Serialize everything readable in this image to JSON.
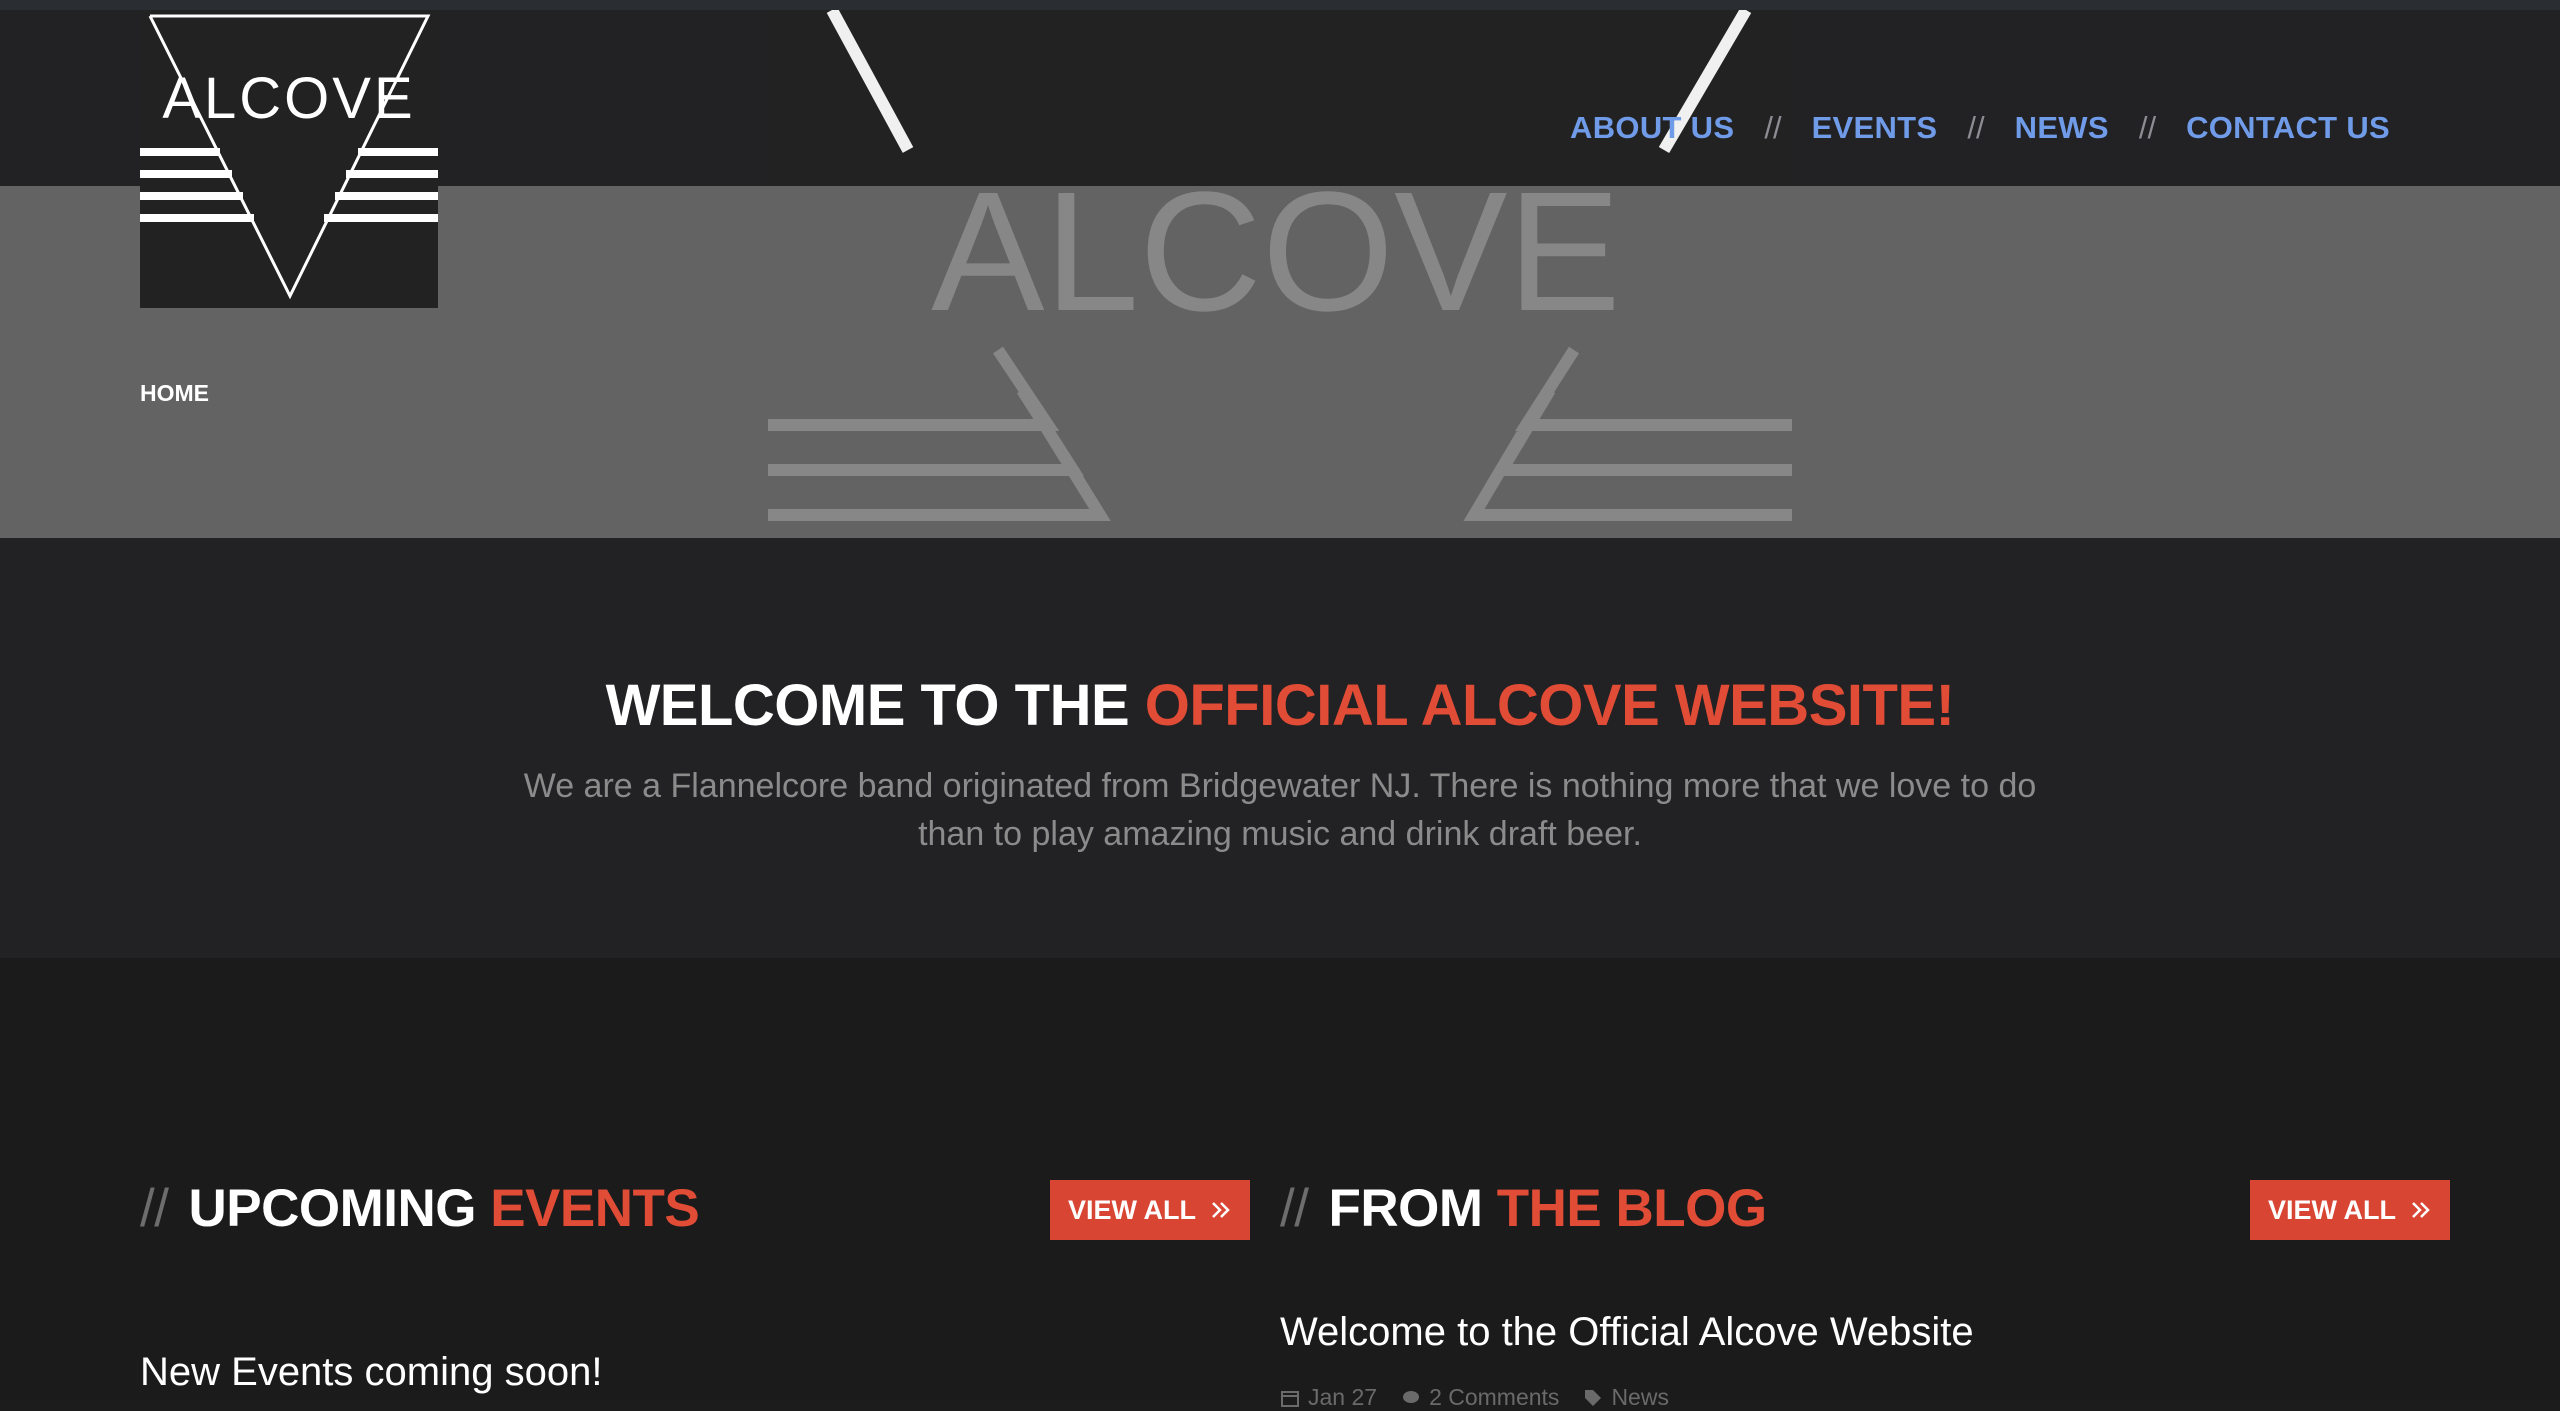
{
  "header": {
    "logo_text": "ALCOVE",
    "nav": [
      {
        "label": "ABOUT US"
      },
      {
        "label": "EVENTS"
      },
      {
        "label": "NEWS"
      },
      {
        "label": "CONTACT US"
      }
    ],
    "separator": "//"
  },
  "hero": {
    "watermark_text": "ALCOVE",
    "breadcrumb": "HOME"
  },
  "welcome": {
    "title_plain": "WELCOME TO THE ",
    "title_accent": "OFFICIAL ALCOVE WEBSITE!",
    "text": "We are a Flannelcore band originated from Bridgewater NJ. There is nothing more that we love to do than to play amazing music and drink draft beer."
  },
  "events": {
    "slashes": "//",
    "title_plain": "UPCOMING",
    "title_accent": "EVENTS",
    "view_all": "VIEW ALL",
    "first_item": "New Events coming soon!"
  },
  "blog": {
    "slashes": "//",
    "title_plain": "FROM",
    "title_accent": "THE BLOG",
    "view_all": "VIEW ALL",
    "post_title": "Welcome to the Official Alcove Website",
    "post_date": "Jan 27",
    "post_comments": "2 Comments",
    "post_category": "News"
  },
  "colors": {
    "accent": "#e04c35",
    "nav_link": "#6f9be8",
    "button": "#d84532",
    "hero": "#636363",
    "header": "#222123"
  },
  "icons": [
    "chevrons-right-icon",
    "calendar-icon",
    "comment-icon",
    "tag-icon"
  ]
}
